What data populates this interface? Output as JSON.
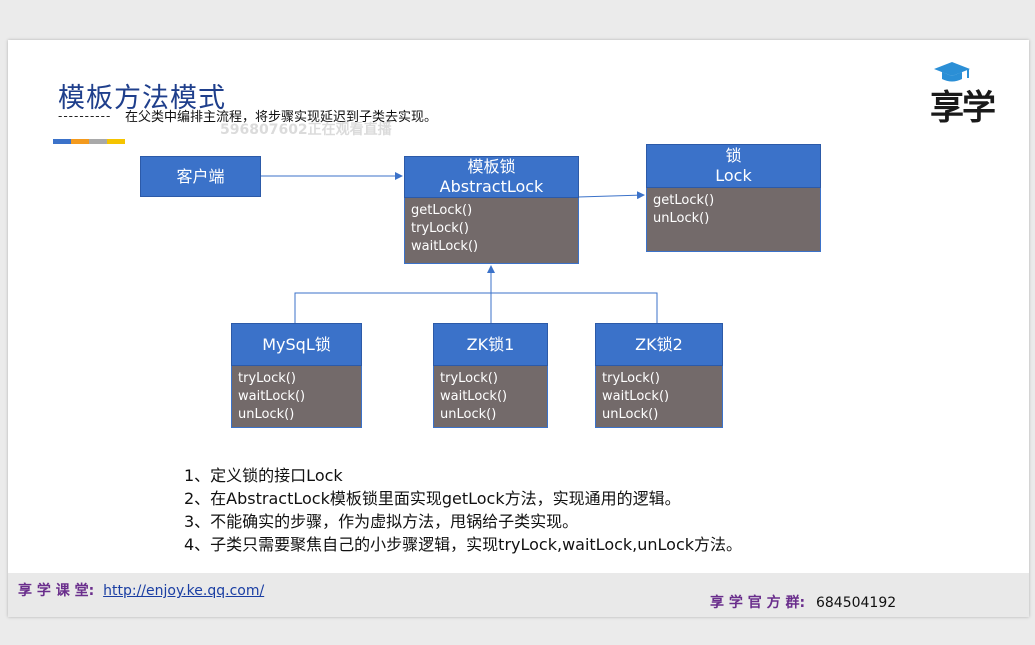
{
  "slide": {
    "title": "模板方法模式",
    "subtitle_dash": "----------",
    "subtitle": "在父类中编排主流程，将步骤实现延迟到子类去实现。",
    "watermark": "5968076​02正在观看直播",
    "colors": [
      "#3b72c9",
      "#f39a1e",
      "#a9a9a9",
      "#f5c400"
    ]
  },
  "logo": {
    "text": "享学",
    "icon": "graduation-cap-icon"
  },
  "diagram": {
    "client": "客户端",
    "template": {
      "title1": "模板锁",
      "title2": "AbstractLock",
      "methods": [
        "getLock()",
        "tryLock()",
        "waitLock()"
      ]
    },
    "lock": {
      "title1": "锁",
      "title2": "Lock",
      "methods": [
        "getLock()",
        "unLock()"
      ]
    },
    "mysql": {
      "title": "MySqL锁",
      "methods": [
        "tryLock()",
        "waitLock()",
        "unLock()"
      ]
    },
    "zk1": {
      "title": "ZK锁1",
      "methods": [
        "tryLock()",
        "waitLock()",
        "unLock()"
      ]
    },
    "zk2": {
      "title": "ZK锁2",
      "methods": [
        "tryLock()",
        "waitLock()",
        "unLock()"
      ]
    }
  },
  "notes": [
    "1、定义锁的接口Lock",
    "2、在AbstractLock模板锁里面实现getLock方法，实现通用的逻辑。",
    "3、不能确实的步骤，作为虚拟方法，甩锅给子类实现。",
    "4、子类只需要聚焦自己的小步骤逻辑，实现tryLock,waitLock,unLock方法。"
  ],
  "footer": {
    "left_label": "享 学 课 堂:",
    "left_link": "http://enjoy.ke.qq.com/",
    "right_label": "享 学 官 方 群:",
    "right_number": "684504192"
  }
}
